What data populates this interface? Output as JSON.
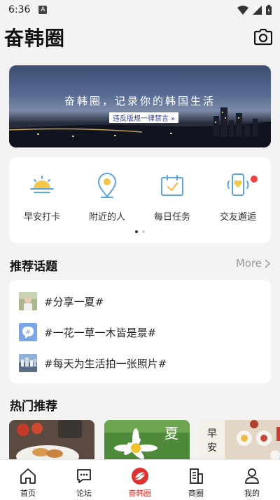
{
  "status_bar": {
    "time": "6:36",
    "notification_letter": "A"
  },
  "header": {
    "title": "奋韩圈",
    "camera_icon": "camera-icon"
  },
  "banner": {
    "title": "奋韩圈，记录你的韩国生活",
    "tag": "违反版规一律禁言 »"
  },
  "quick_actions": [
    {
      "label": "早安打卡",
      "icon": "sunrise-icon",
      "badge": false
    },
    {
      "label": "附近的人",
      "icon": "location-pin-icon",
      "badge": false
    },
    {
      "label": "每日任务",
      "icon": "calendar-check-icon",
      "badge": false
    },
    {
      "label": "交友邂逅",
      "icon": "phone-heart-icon",
      "badge": true
    }
  ],
  "quick_pages": {
    "total": 2,
    "current": 1
  },
  "topics_section": {
    "title": "推荐话题",
    "more": "More"
  },
  "topics": [
    {
      "text": "#分享一夏#",
      "thumb": "person-photo"
    },
    {
      "text": "#一花一草一木皆是景#",
      "thumb": "hashtag-icon"
    },
    {
      "text": "#每天为生活拍一张照片#",
      "thumb": "city-photo"
    }
  ],
  "hot_section": {
    "title": "热门推荐"
  },
  "tabs": [
    {
      "label": "首页",
      "icon": "home-icon",
      "active": false
    },
    {
      "label": "论坛",
      "icon": "forum-icon",
      "active": false
    },
    {
      "label": "奋韩圈",
      "icon": "fenhan-logo-icon",
      "active": true
    },
    {
      "label": "商圈",
      "icon": "shop-icon",
      "active": false
    },
    {
      "label": "我的",
      "icon": "profile-icon",
      "active": false
    }
  ],
  "colors": {
    "accent": "#e03030",
    "icon_blue": "#5aa5e0",
    "icon_yellow": "#f6c648"
  }
}
